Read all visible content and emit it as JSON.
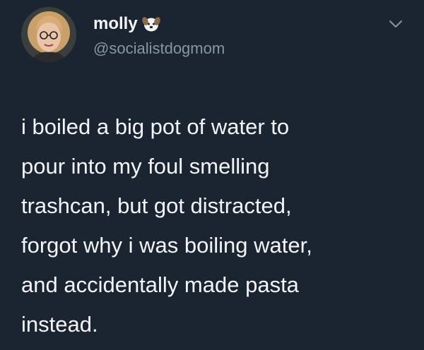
{
  "user": {
    "display_name": "molly",
    "handle": "@socialistdogmom",
    "name_emoji": "dog-face-icon"
  },
  "tweet": {
    "lines": [
      "i boiled a big pot of water to",
      "pour into my foul smelling",
      "trashcan, but got distracted,",
      "forgot why i was boiling water,",
      "and accidentally made pasta",
      "instead."
    ]
  },
  "icons": {
    "menu": "chevron-down-icon",
    "avatar": "profile-photo"
  },
  "colors": {
    "background": "#1b2431",
    "name": "#f2f4f7",
    "handle": "#8a96a3",
    "text": "#f3f5f8"
  }
}
